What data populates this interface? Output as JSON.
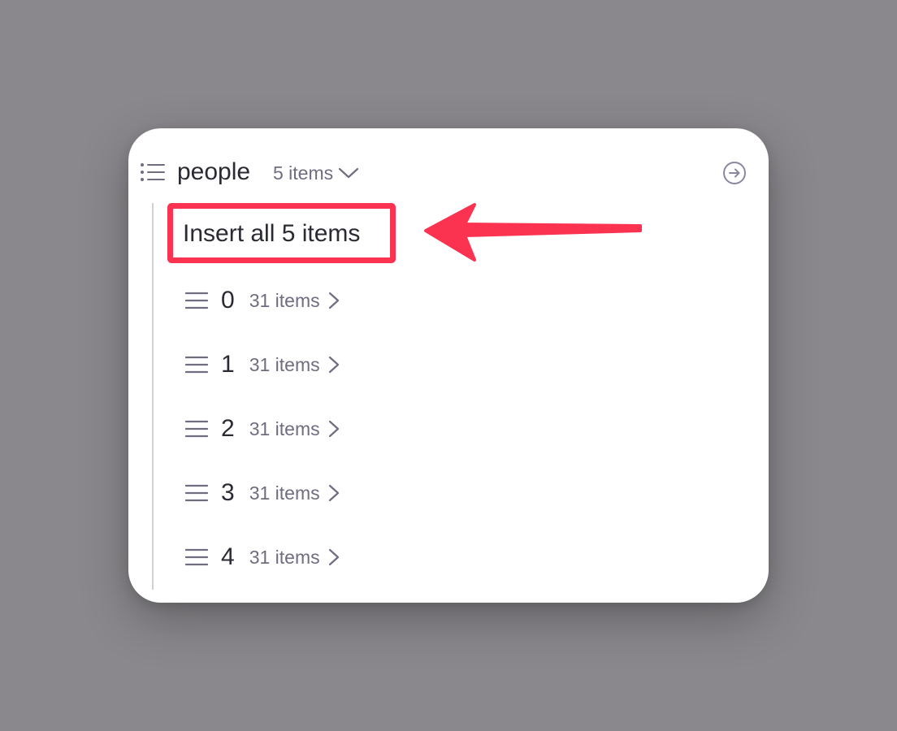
{
  "header": {
    "title": "people",
    "count_label": "5 items"
  },
  "insert_button": {
    "label": "Insert all 5 items"
  },
  "items": [
    {
      "index": "0",
      "count_label": "31 items"
    },
    {
      "index": "1",
      "count_label": "31 items"
    },
    {
      "index": "2",
      "count_label": "31 items"
    },
    {
      "index": "3",
      "count_label": "31 items"
    },
    {
      "index": "4",
      "count_label": "31 items"
    }
  ],
  "icons": {
    "header": "list-icon",
    "count_toggle": "chevron-down-icon",
    "goto": "arrow-right-circle-icon",
    "row_handle": "drag-handle-icon",
    "row_expand": "chevron-right-icon",
    "annotation": "red-arrow"
  },
  "colors": {
    "background": "#8a888c",
    "panel": "#ffffff",
    "highlight": "#fb3350",
    "text_primary": "#2a2a33",
    "text_secondary": "#6f6d80"
  }
}
